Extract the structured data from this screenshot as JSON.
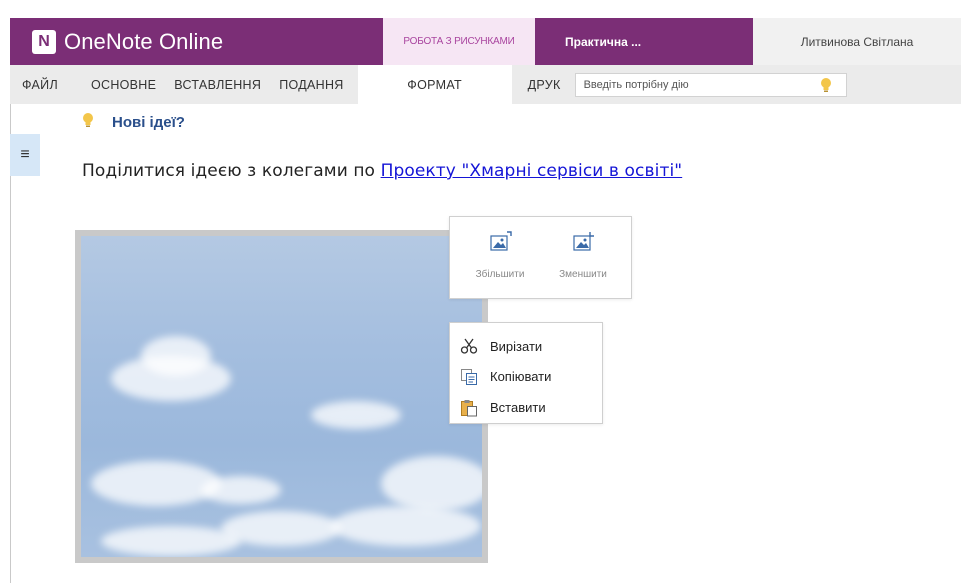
{
  "app": {
    "title": "OneNote Online",
    "logo_letter": "N",
    "accent_color": "#7b2e76"
  },
  "titlebar": {
    "context_tab": "РОБОТА З РИСУНКАМИ",
    "notebook": "Практична ...",
    "user": "Литвинова Світлана"
  },
  "ribbon": {
    "tabs": [
      "ФАЙЛ",
      "ОСНОВНЕ",
      "ВСТАВЛЕННЯ",
      "ПОДАННЯ",
      "ФОРМАТ",
      "ДРУК"
    ],
    "active_tab": "ФОРМАТ",
    "search_placeholder": "Введіть потрібну дію",
    "search_icon": "lightbulb-icon"
  },
  "nav": {
    "menu_icon": "≡"
  },
  "page": {
    "idea_title": "Нові ідеї?",
    "share_text": "Поділитися ідеєю з колегами по ",
    "share_link": "Проекту \"Хмарні сервіси в освіті\""
  },
  "zoom_panel": {
    "enlarge_label": "Збільшити",
    "shrink_label": "Зменшити"
  },
  "context_menu": {
    "items": [
      {
        "label": "Вирізати",
        "icon": "scissors-icon"
      },
      {
        "label": "Копіювати",
        "icon": "copy-icon"
      },
      {
        "label": "Вставити",
        "icon": "paste-icon"
      }
    ]
  }
}
